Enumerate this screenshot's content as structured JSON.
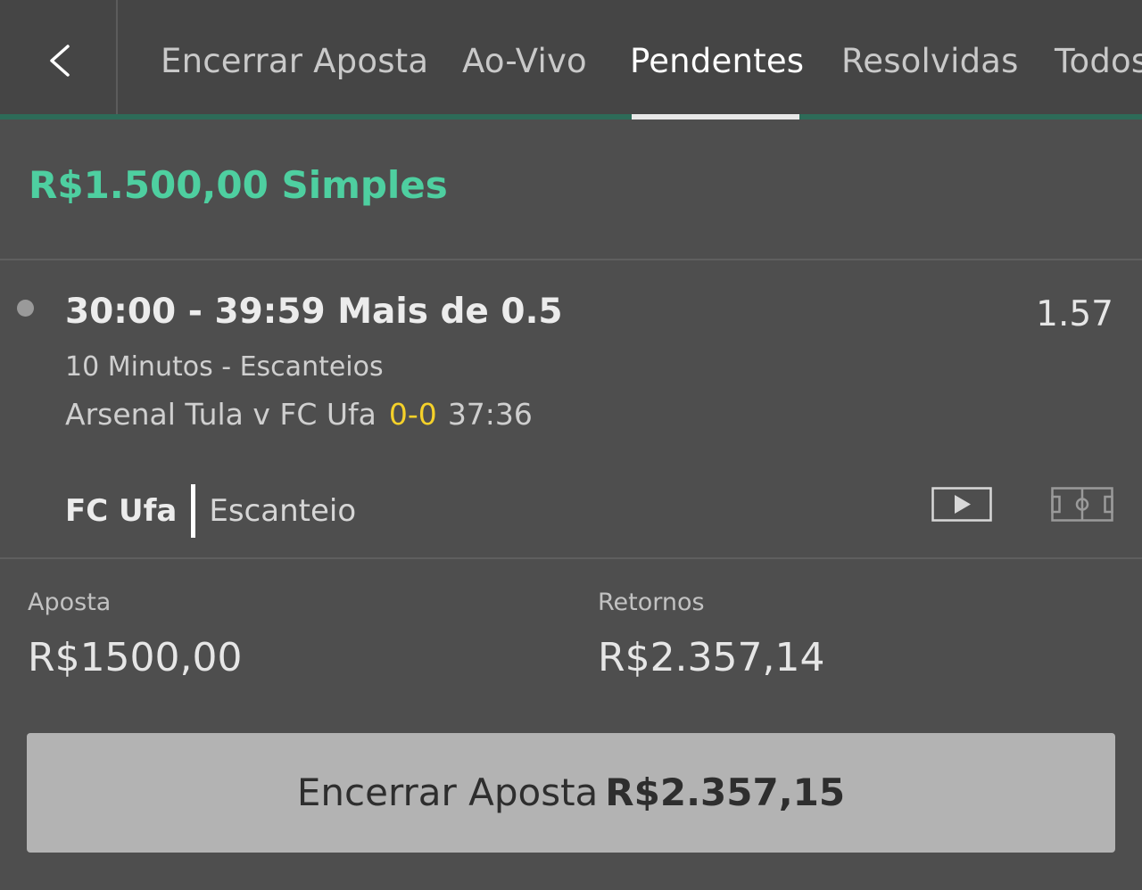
{
  "nav": {
    "back_icon": "chevron-left-icon",
    "tabs": [
      {
        "label": "Encerrar Aposta",
        "active": false
      },
      {
        "label": "Ao-Vivo",
        "active": false
      },
      {
        "label": "Pendentes",
        "active": true
      },
      {
        "label": "Resolvidas",
        "active": false
      },
      {
        "label": "Todos",
        "active": false
      }
    ]
  },
  "bet": {
    "title": "R$1.500,00 Simples",
    "selection": {
      "name": "30:00 - 39:59 Mais de 0.5",
      "odds": "1.57",
      "market": "10 Minutos - Escanteios",
      "event": "Arsenal Tula v FC Ufa",
      "score": "0-0",
      "clock": "37:36",
      "last_incident_team": "FC Ufa",
      "last_incident_type": "Escanteio",
      "icons": [
        "play-video-icon",
        "pitch-icon"
      ]
    },
    "stake_label": "Aposta",
    "stake_value": "R$1500,00",
    "returns_label": "Retornos",
    "returns_value": "R$2.357,14",
    "cashout_label": "Encerrar Aposta",
    "cashout_value": "R$2.357,15"
  },
  "colors": {
    "accent_green": "#4ecfa0",
    "score_yellow": "#f5d12a",
    "background": "#4e4e4e"
  }
}
